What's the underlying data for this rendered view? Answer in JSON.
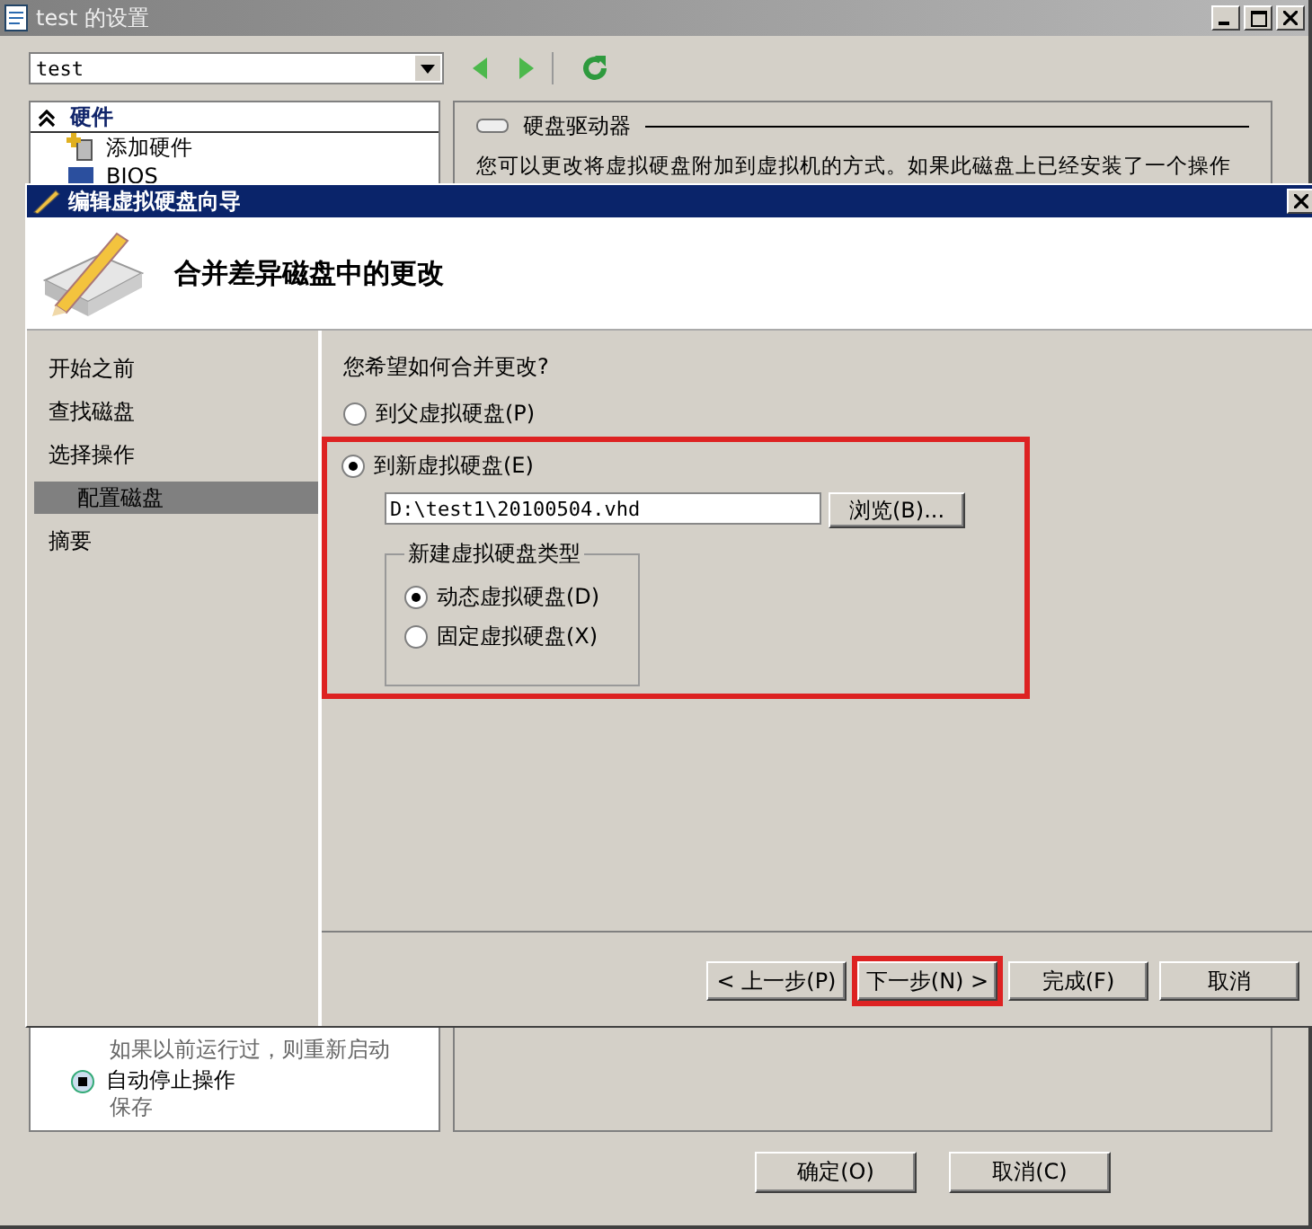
{
  "window": {
    "title": "test 的设置",
    "vm_select": "test"
  },
  "tree": {
    "section": "硬件",
    "expanded": true,
    "items": [
      {
        "label": "添加硬件",
        "kind": "add"
      },
      {
        "label": "BIOS",
        "kind": "chip"
      }
    ],
    "lower_items": [
      {
        "value": "如果以前运行过，则重新启动"
      },
      {
        "label": "自动停止操作",
        "value": "保存"
      }
    ]
  },
  "details": {
    "heading": "硬盘驱动器",
    "text": "您可以更改将虚拟硬盘附加到虚拟机的方式。如果此磁盘上已经安装了一个操作"
  },
  "buttons": [
    {
      "label": "确定(O)"
    },
    {
      "label": "取消(C)"
    }
  ],
  "wizard": {
    "title": "编辑虚拟硬盘向导",
    "heading": "合并差异磁盘中的更改",
    "steps": [
      {
        "label": "开始之前",
        "selected": false,
        "sub": false
      },
      {
        "label": "查找磁盘",
        "selected": false,
        "sub": false
      },
      {
        "label": "选择操作",
        "selected": false,
        "sub": false
      },
      {
        "label": "配置磁盘",
        "selected": true,
        "sub": true
      },
      {
        "label": "摘要",
        "selected": false,
        "sub": false
      }
    ],
    "question": "您希望如何合并更改?",
    "options": [
      {
        "label": "到父虚拟硬盘(P)",
        "selected": false,
        "annotated": false
      },
      {
        "label": "到新虚拟硬盘(E)",
        "selected": true,
        "annotated": true
      }
    ],
    "path": "D:\\test1\\20100504.vhd",
    "browse": "浏览(B)...",
    "group_title": "新建虚拟硬盘类型",
    "disk_types": [
      {
        "label": "动态虚拟硬盘(D)",
        "selected": true
      },
      {
        "label": "固定虚拟硬盘(X)",
        "selected": false
      }
    ],
    "buttons": [
      {
        "label": "< 上一步(P)",
        "annotated": false
      },
      {
        "label": "下一步(N) >",
        "annotated": true
      },
      {
        "label": "完成(F)",
        "annotated": false
      },
      {
        "label": "取消",
        "annotated": false
      }
    ]
  }
}
